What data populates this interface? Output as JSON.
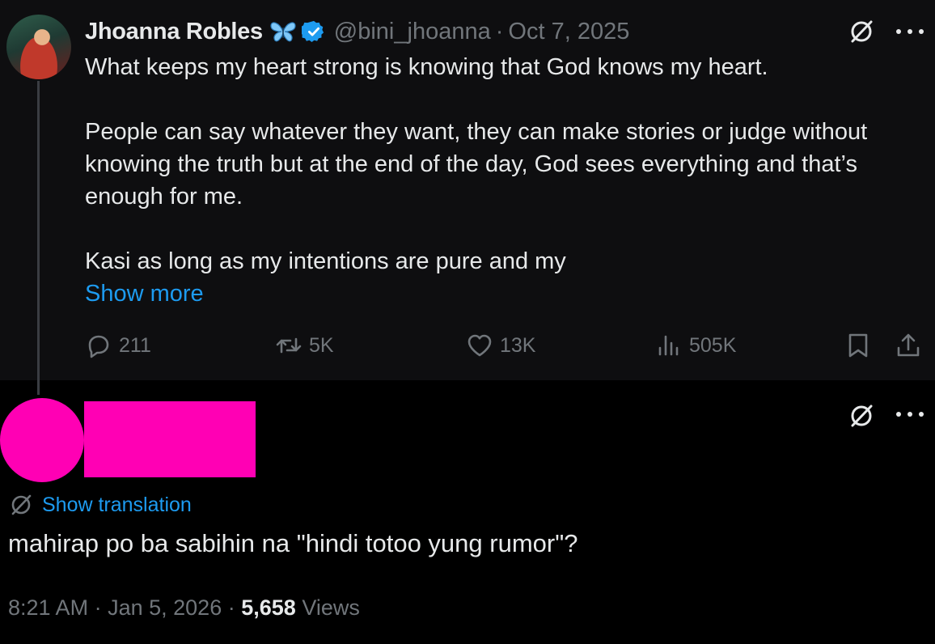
{
  "quoted_post": {
    "author_name": "Jhoanna Robles",
    "handle": "@bini_jhoanna",
    "separator": "·",
    "date": "Oct 7, 2025",
    "lines": [
      "What keeps my heart strong is knowing that God knows my heart.",
      "",
      "People can say whatever they want, they can make stories or judge without",
      "knowing the truth but at the end of the day, God sees everything and that’s",
      "enough for me.",
      "",
      "Kasi as long as my intentions are pure and my"
    ],
    "show_more_label": "Show more",
    "stats": {
      "replies": "211",
      "reposts": "5K",
      "likes": "13K",
      "views": "505K"
    }
  },
  "reply": {
    "show_translation_label": "Show translation",
    "text": "mahirap po ba sabihin na \"hindi totoo yung rumor\"?",
    "time": "8:21 AM",
    "separator": "·",
    "date": "Jan 5, 2026",
    "views_count": "5,658",
    "views_label": "Views"
  },
  "colors": {
    "accent": "#1d9bf0",
    "redaction": "#ff00b4",
    "muted": "#71767b",
    "text": "#e7e9ea"
  },
  "icons": [
    "butterfly-icon",
    "verified-badge-icon",
    "grok-icon",
    "more-icon",
    "reply-icon",
    "repost-icon",
    "like-icon",
    "views-icon",
    "bookmark-icon",
    "share-icon",
    "translate-icon"
  ]
}
